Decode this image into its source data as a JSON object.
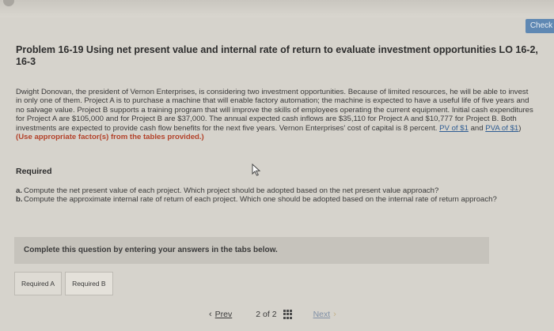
{
  "header": {
    "ghost_left": "",
    "ghost_right": "",
    "check_label": "Check"
  },
  "problem": {
    "title": "Problem 16-19 Using net present value and internal rate of return to evaluate investment opportunities LO 16-2, 16-3",
    "body": "Dwight Donovan, the president of Vernon Enterprises, is considering two investment opportunities. Because of limited resources, he will be able to invest in only one of them. Project A is to purchase a machine that will enable factory automation; the machine is expected to have a useful life of five years and no salvage value. Project B supports a training program that will improve the skills of employees operating the current equipment. Initial cash expenditures for Project A are $105,000 and for Project B are $37,000. The annual expected cash inflows are $35,110 for Project A and $10,777 for Project B. Both investments are expected to provide cash flow benefits for the next five years. Vernon Enterprises' cost of capital is 8 percent.",
    "link_pv": "PV of $1",
    "link_and": "and",
    "link_pva": "PVA of $1",
    "factor_note": "(Use appropriate factor(s) from the tables provided.)"
  },
  "required": {
    "label": "Required",
    "items": [
      {
        "letter": "a.",
        "text": "Compute the net present value of each project. Which project should be adopted based on the net present value approach?"
      },
      {
        "letter": "b.",
        "text": "Compute the approximate internal rate of return of each project. Which one should be adopted based on the internal rate of return approach?"
      }
    ]
  },
  "instructions": {
    "complete_text": "Complete this question by entering your answers in the tabs below."
  },
  "tabs": [
    {
      "label": "Required A"
    },
    {
      "label": "Required B"
    }
  ],
  "pager": {
    "prev_label": "Prev",
    "page": "2",
    "of": "of",
    "total": "2",
    "next_label": "Next"
  },
  "icons": {
    "cursor": "mouse-cursor-icon",
    "grid": "grid-menu-icon",
    "prev": "chevron-left-icon",
    "next": "chevron-right-icon"
  }
}
